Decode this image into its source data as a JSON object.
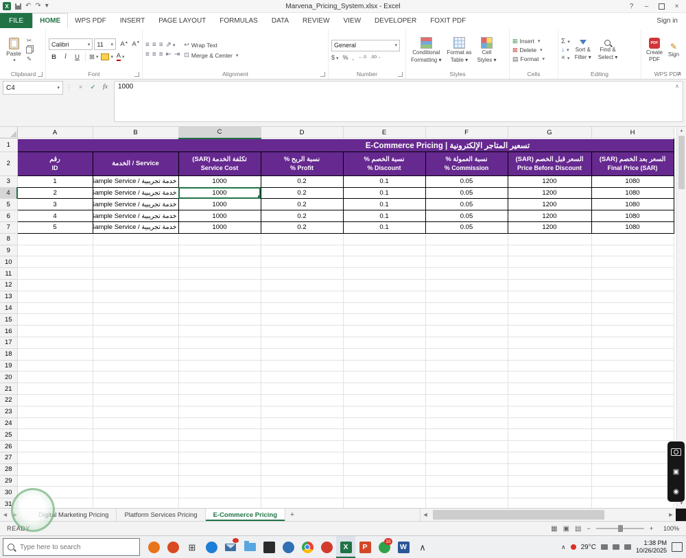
{
  "colors": {
    "excel_green": "#217346",
    "header_purple": "#66298f",
    "badge_red": "#d93025",
    "wps_red": "#d13438"
  },
  "titlebar": {
    "title": "Marvena_Pricing_System.xlsx - Excel",
    "help": "?",
    "minimize": "–",
    "close": "×"
  },
  "sign_in": "Sign in",
  "ribbon_tabs": [
    {
      "label": "FILE",
      "style": "file"
    },
    {
      "label": "HOME",
      "style": "active"
    },
    {
      "label": "WPS PDF"
    },
    {
      "label": "INSERT"
    },
    {
      "label": "PAGE LAYOUT"
    },
    {
      "label": "FORMULAS"
    },
    {
      "label": "DATA"
    },
    {
      "label": "REVIEW"
    },
    {
      "label": "VIEW"
    },
    {
      "label": "DEVELOPER"
    },
    {
      "label": "FOXIT PDF"
    }
  ],
  "ribbon": {
    "paste": "Paste",
    "clipboard_label": "Clipboard",
    "font_name": "Calibri",
    "font_size": "11",
    "bold": "B",
    "italic": "I",
    "underline": "U",
    "font_label": "Font",
    "wrap_text": "Wrap Text",
    "merge_center": "Merge & Center",
    "alignment_label": "Alignment",
    "number_format": "General",
    "currency": "$",
    "percent": "%",
    "comma": ",",
    "inc_decimal": "←.0",
    "dec_decimal": ".00→",
    "number_label": "Number",
    "cond_fmt_1": "Conditional",
    "cond_fmt_2": "Formatting",
    "fmt_table_1": "Format as",
    "fmt_table_2": "Table",
    "cell_styles_1": "Cell",
    "cell_styles_2": "Styles",
    "styles_label": "Styles",
    "insert": "Insert",
    "delete": "Delete",
    "format": "Format",
    "cells_label": "Cells",
    "autosum": "Σ",
    "sort_1": "Sort &",
    "sort_2": "Filter",
    "find_1": "Find &",
    "find_2": "Select",
    "editing_label": "Editing",
    "create_pdf_1": "Create",
    "create_pdf_2": "PDF",
    "pdf_badge": "PDF",
    "sign": "Sign",
    "wps_label": "WPS PDF"
  },
  "formula_bar": {
    "name_box": "C4",
    "cancel": "×",
    "enter": "✓",
    "fx": "fx",
    "content": "1000"
  },
  "grid": {
    "columns": [
      "A",
      "B",
      "C",
      "D",
      "E",
      "F",
      "G",
      "H"
    ],
    "active_col": "C",
    "active_row": 4,
    "rows_total": 33,
    "title": "E-Commerce Pricing | تسعير المتاجر الإلكترونية",
    "headers": [
      {
        "ar": "رقم",
        "en": "ID"
      },
      {
        "ar": "Service / الخدمة",
        "en": ""
      },
      {
        "ar": "تكلفة الخدمة (SAR)",
        "en": "Service Cost"
      },
      {
        "ar": "نسبة الربح %",
        "en": "% Profit"
      },
      {
        "ar": "نسبة الخصم %",
        "en": "% Discount"
      },
      {
        "ar": "نسبة العمولة %",
        "en": "% Commission"
      },
      {
        "ar": "السعر قبل الخصم (SAR)",
        "en": "Price Before Discount"
      },
      {
        "ar": "السعر بعد الخصم (SAR)",
        "en": "Final Price (SAR)"
      }
    ],
    "data_rows": [
      [
        "1",
        "Sample Service / خدمة تجريبية",
        "1000",
        "0.2",
        "0.1",
        "0.05",
        "1200",
        "1080"
      ],
      [
        "2",
        "Sample Service / خدمة تجريبية",
        "1000",
        "0.2",
        "0.1",
        "0.05",
        "1200",
        "1080"
      ],
      [
        "3",
        "Sample Service / خدمة تجريبية",
        "1000",
        "0.2",
        "0.1",
        "0.05",
        "1200",
        "1080"
      ],
      [
        "4",
        "Sample Service / خدمة تجريبية",
        "1000",
        "0.2",
        "0.1",
        "0.05",
        "1200",
        "1080"
      ],
      [
        "5",
        "Sample Service / خدمة تجريبية",
        "1000",
        "0.2",
        "0.1",
        "0.05",
        "1200",
        "1080"
      ]
    ]
  },
  "sheet_tabs": {
    "more": "…",
    "tabs": [
      {
        "label": "Digital Marketing Pricing",
        "active": false
      },
      {
        "label": "Platform Services Pricing",
        "active": false
      },
      {
        "label": "E-Commerce Pricing",
        "active": true
      }
    ],
    "add": "+"
  },
  "status": {
    "mode": "READY",
    "zoom": "100%"
  },
  "taskbar": {
    "search_placeholder": "Type here to search",
    "apps": [
      {
        "name": "pumpkin-icon",
        "kind": "circle",
        "color": "#e8731a"
      },
      {
        "name": "pumpkin2-icon",
        "kind": "circle",
        "color": "#d84b20"
      },
      {
        "name": "task-view-icon",
        "kind": "glyph",
        "glyph": "⊞",
        "color": "#333333"
      },
      {
        "name": "edge-icon",
        "kind": "circle",
        "color": "#1e7fd6"
      },
      {
        "name": "mail-icon",
        "kind": "mail",
        "color": "#3a6ea5",
        "badge": "dot"
      },
      {
        "name": "folder-icon",
        "kind": "folder",
        "color": "#58a6e0"
      },
      {
        "name": "camera-app-icon",
        "kind": "square",
        "color": "#2b2b2b"
      },
      {
        "name": "globe-icon",
        "kind": "circle",
        "color": "#2f6fb3"
      },
      {
        "name": "chrome-icon",
        "kind": "chrome"
      },
      {
        "name": "opera-icon",
        "kind": "circle",
        "color": "#d33a2c"
      },
      {
        "name": "excel-taskbar-icon",
        "kind": "app",
        "letter": "X",
        "color": "#217346",
        "active": true
      },
      {
        "name": "powerpoint-icon",
        "kind": "app",
        "letter": "P",
        "color": "#d24726"
      },
      {
        "name": "chat-icon",
        "kind": "circle",
        "color": "#31a24c",
        "badge": "33"
      },
      {
        "name": "word-icon",
        "kind": "app",
        "letter": "W",
        "color": "#2b579a"
      },
      {
        "name": "hidden-icons-chevron",
        "kind": "glyph",
        "glyph": "∧",
        "color": "#333333"
      }
    ],
    "tray": {
      "temp": "29°C",
      "time": "1:38 PM",
      "date": "10/26/2025"
    }
  }
}
